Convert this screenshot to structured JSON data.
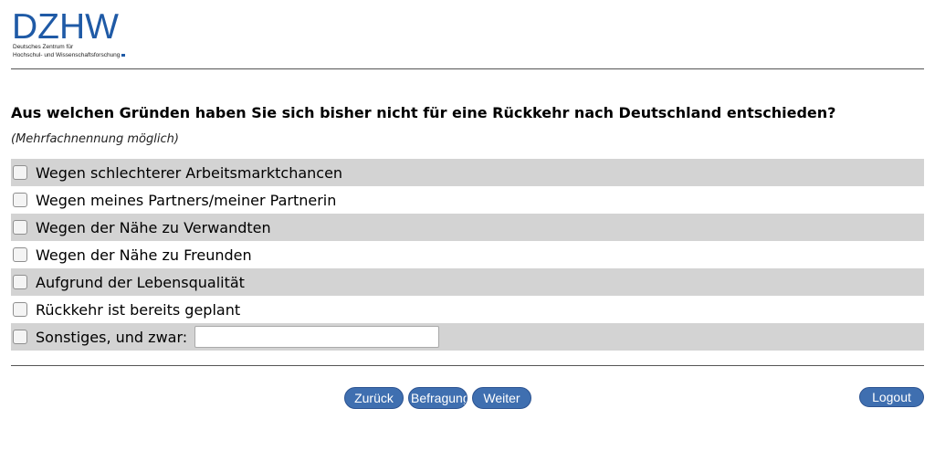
{
  "logo": {
    "wordmark": "DZHW",
    "subtitle_line1": "Deutsches Zentrum für",
    "subtitle_line2": "Hochschul- und Wissenschaftsforschung"
  },
  "question": {
    "text": "Aus welchen Gründen haben Sie sich bisher nicht für eine Rückkehr nach Deutschland entschieden?",
    "hint": "(Mehrfachnennung möglich)"
  },
  "options": [
    {
      "label": "Wegen schlechterer Arbeitsmarktchancen",
      "checked": false
    },
    {
      "label": "Wegen meines Partners/meiner Partnerin",
      "checked": false
    },
    {
      "label": "Wegen der Nähe zu Verwandten",
      "checked": false
    },
    {
      "label": "Wegen der Nähe zu Freunden",
      "checked": false
    },
    {
      "label": "Aufgrund der Lebensqualität",
      "checked": false
    },
    {
      "label": "Rückkehr ist bereits geplant",
      "checked": false
    },
    {
      "label": "Sonstiges, und zwar:",
      "checked": false,
      "input_value": ""
    }
  ],
  "nav": {
    "back_label": "Zurück",
    "survey_label": "Befragung",
    "next_label": "Weiter",
    "logout_label": "Logout"
  },
  "colors": {
    "brand_blue": "#1f5aa6",
    "button_blue": "#3f6fb0",
    "row_stripe": "#d3d3d3"
  }
}
